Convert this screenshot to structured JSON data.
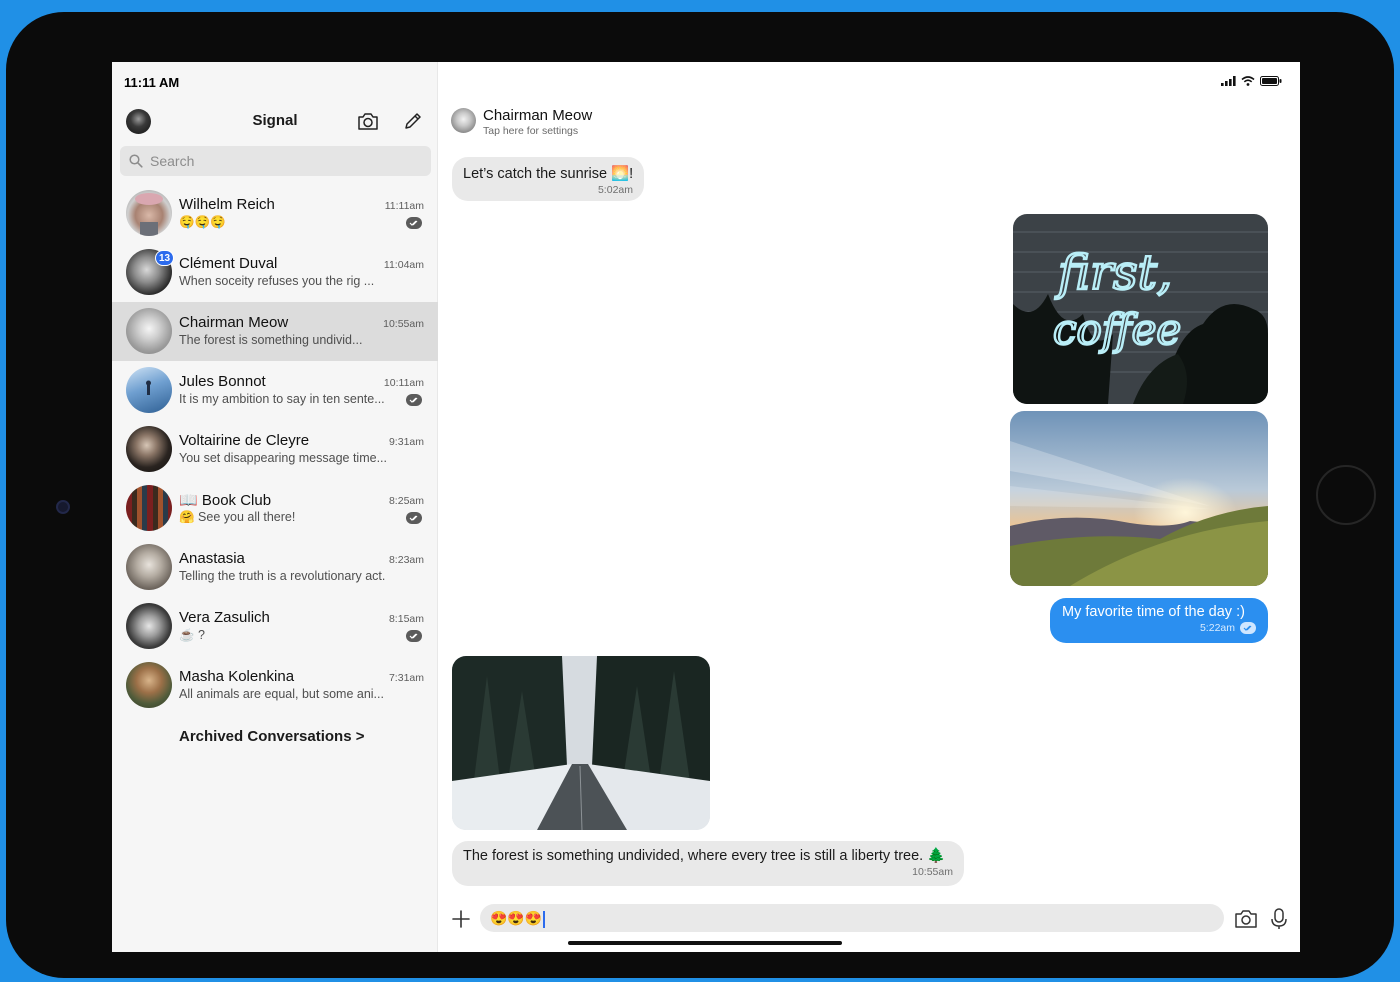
{
  "status_bar": {
    "time": "11:11 AM"
  },
  "sidebar": {
    "title": "Signal",
    "search": {
      "placeholder": "Search"
    },
    "conversations": [
      {
        "name": "Wilhelm Reich",
        "time": "11:11am",
        "snippet": "🤤🤤🤤",
        "badge": "",
        "receipt": true
      },
      {
        "name": "Clément Duval",
        "time": "11:04am",
        "snippet": "When soceity refuses you the rig ...",
        "badge": "13",
        "receipt": false
      },
      {
        "name": "Chairman Meow",
        "time": "10:55am",
        "snippet": "The forest is something undivid...",
        "badge": "",
        "receipt": false,
        "selected": true
      },
      {
        "name": "Jules Bonnot",
        "time": "10:11am",
        "snippet": "It is my ambition to say in ten sente...",
        "badge": "",
        "receipt": true
      },
      {
        "name": "Voltairine de Cleyre",
        "time": "9:31am",
        "snippet": "You set disappearing message time...",
        "badge": "",
        "receipt": false
      },
      {
        "name": "📖 Book Club",
        "time": "8:25am",
        "snippet": "🤗 See you all there!",
        "badge": "",
        "receipt": true
      },
      {
        "name": "Anastasia",
        "time": "8:23am",
        "snippet": "Telling the truth is a revolutionary act.",
        "badge": "",
        "receipt": false
      },
      {
        "name": "Vera Zasulich",
        "time": "8:15am",
        "snippet": "☕ ?",
        "badge": "",
        "receipt": true
      },
      {
        "name": "Masha Kolenkina",
        "time": "7:31am",
        "snippet": "All animals are equal, but some ani...",
        "badge": "",
        "receipt": false
      }
    ],
    "archived_label": "Archived Conversations >"
  },
  "chat": {
    "contact_name": "Chairman Meow",
    "contact_sub": "Tap here for settings",
    "messages": [
      {
        "direction": "in",
        "text": "Let’s catch the sunrise 🌅!",
        "time": "5:02am"
      },
      {
        "direction": "out",
        "type": "image",
        "alt": "first coffee neon"
      },
      {
        "direction": "out",
        "type": "image",
        "alt": "sunrise over mountains"
      },
      {
        "direction": "out",
        "text": "My favorite time of the day :)",
        "time": "5:22am"
      },
      {
        "direction": "in",
        "type": "image",
        "alt": "snowy forest road"
      },
      {
        "direction": "in",
        "text": "The forest is something undivided, where every tree is still a liberty tree. 🌲",
        "time": "10:55am"
      }
    ],
    "composer": {
      "value": "😍😍😍"
    }
  },
  "colors": {
    "accent": "#2c6bed",
    "outgoing_bubble": "#2b8ff0",
    "incoming_bubble": "#e9e9e9",
    "device_bg": "#2090e6"
  }
}
